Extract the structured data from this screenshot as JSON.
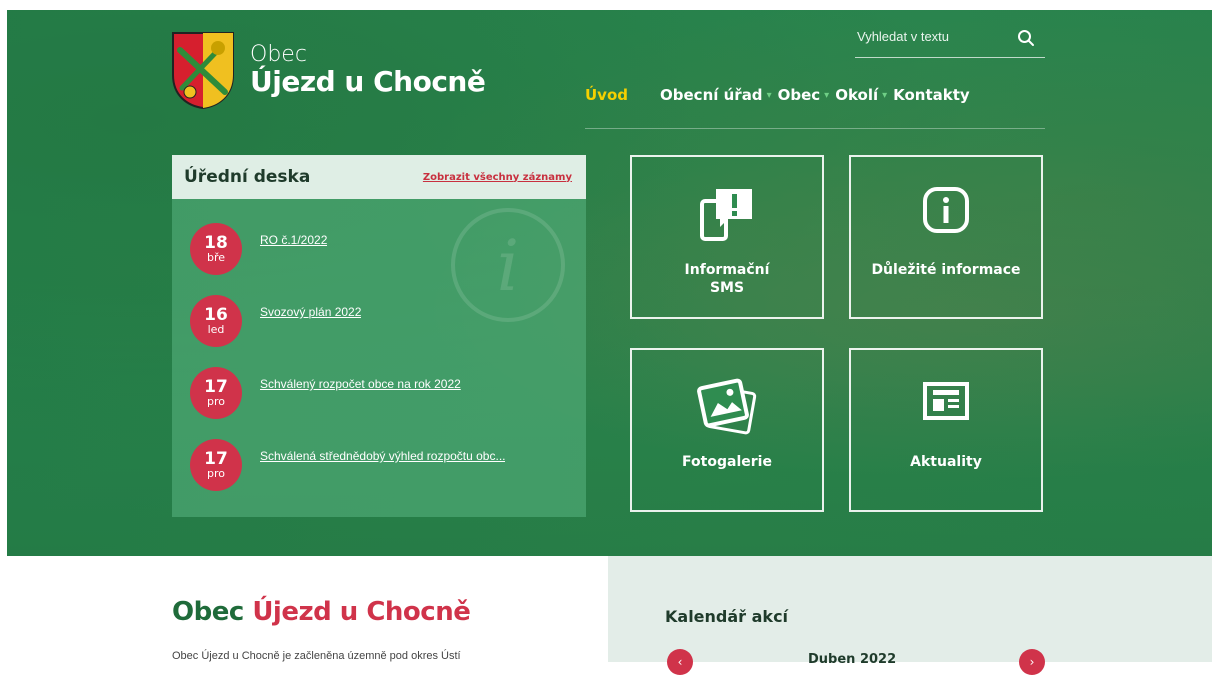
{
  "header": {
    "logo_small": "Obec",
    "logo_big": "Újezd u Chocně",
    "search_placeholder": "Vyhledat v textu"
  },
  "nav": {
    "items": [
      {
        "label": "Úvod",
        "active": true,
        "has_submenu": false
      },
      {
        "label": "Obecní úřad",
        "active": false,
        "has_submenu": true
      },
      {
        "label": "Obec",
        "active": false,
        "has_submenu": true
      },
      {
        "label": "Okolí",
        "active": false,
        "has_submenu": true
      },
      {
        "label": "Kontakty",
        "active": false,
        "has_submenu": false
      }
    ]
  },
  "board": {
    "title": "Úřední deska",
    "show_all": "Zobrazit všechny záznamy",
    "entries": [
      {
        "day": "18",
        "month": "bře",
        "title": "RO č.1/2022"
      },
      {
        "day": "16",
        "month": "led",
        "title": "Svozový plán 2022"
      },
      {
        "day": "17",
        "month": "pro",
        "title": "Schválený rozpočet obce na rok 2022"
      },
      {
        "day": "17",
        "month": "pro",
        "title": "Schválená střednědobý výhled rozpočtu obc..."
      }
    ]
  },
  "tiles": [
    {
      "label_line1": "Informační",
      "label_line2": "SMS",
      "icon": "sms-alert-icon"
    },
    {
      "label_line1": "Důležité informace",
      "label_line2": "",
      "icon": "info-icon"
    },
    {
      "label_line1": "Fotogalerie",
      "label_line2": "",
      "icon": "gallery-icon"
    },
    {
      "label_line1": "Aktuality",
      "label_line2": "",
      "icon": "news-icon"
    }
  ],
  "about": {
    "title_prefix": "Obec ",
    "title_name": "Újezd u Chocně",
    "text": "Obec Újezd u Chocně je začleněna územně pod okres Ústí"
  },
  "calendar": {
    "title": "Kalendář akcí",
    "month": "Duben 2022",
    "prev": "‹",
    "next": "›"
  },
  "colors": {
    "brand_green": "#1f6b3a",
    "accent_red": "#d0334a",
    "active_nav": "#f5d000"
  }
}
